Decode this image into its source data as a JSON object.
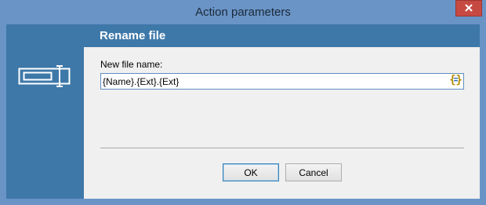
{
  "window": {
    "title": "Action parameters"
  },
  "header": {
    "title": "Rename file"
  },
  "form": {
    "field_label": "New file name:",
    "field_value": "{Name}.{Ext}.{Ext}"
  },
  "buttons": {
    "ok_label": "OK",
    "cancel_label": "Cancel"
  },
  "icons": {
    "close": "close-icon",
    "sidebar": "rename-field-icon",
    "macro": "braces-macro-icon"
  },
  "colors": {
    "titlebar": "#6a94c6",
    "accent": "#3e78a9",
    "close": "#c74a42",
    "content_bg": "#f0f0f0"
  }
}
